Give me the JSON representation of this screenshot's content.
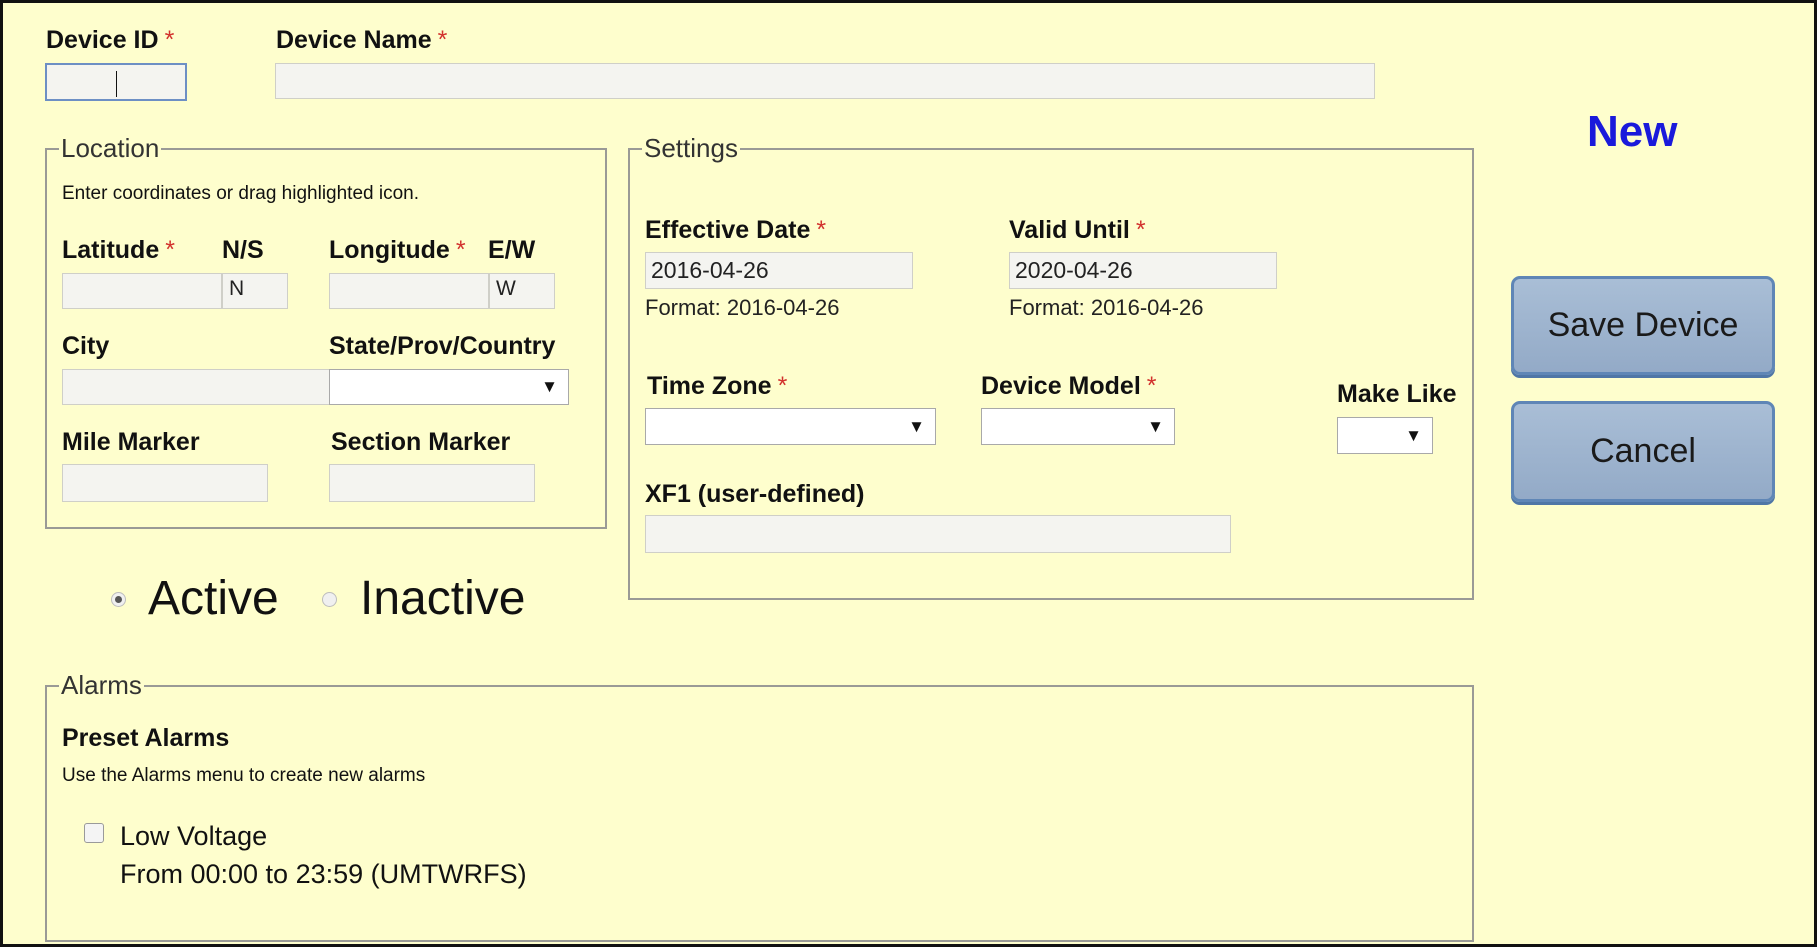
{
  "required_mark": "*",
  "device": {
    "id_label": "Device ID",
    "id_value": "",
    "name_label": "Device Name",
    "name_value": ""
  },
  "status_label": "New",
  "location": {
    "legend": "Location",
    "hint": "Enter coordinates or drag highlighted icon.",
    "latitude_label": "Latitude",
    "ns_label": "N/S",
    "ns_value": "N",
    "longitude_label": "Longitude",
    "ew_label": "E/W",
    "ew_value": "W",
    "city_label": "City",
    "state_label": "State/Prov/Country",
    "mile_marker_label": "Mile Marker",
    "section_marker_label": "Section Marker"
  },
  "activity": {
    "active_label": "Active",
    "inactive_label": "Inactive",
    "selected": "Active"
  },
  "settings": {
    "legend": "Settings",
    "effective_date_label": "Effective Date",
    "effective_date_value": "2016-04-26",
    "effective_date_format": "Format: 2016-04-26",
    "valid_until_label": "Valid Until",
    "valid_until_value": "2020-04-26",
    "valid_until_format": "Format: 2016-04-26",
    "time_zone_label": "Time Zone",
    "device_model_label": "Device Model",
    "make_like_label": "Make Like",
    "xf1_label": "XF1 (user-defined)"
  },
  "buttons": {
    "save_label": "Save Device",
    "cancel_label": "Cancel"
  },
  "alarms": {
    "legend": "Alarms",
    "preset_title": "Preset Alarms",
    "hint": "Use the Alarms menu to create new alarms",
    "items": [
      {
        "label": "Low Voltage",
        "schedule": "From 00:00 to 23:59 (UMTWRFS)",
        "checked": false
      }
    ]
  },
  "icons": {
    "dropdown_arrow": "▼"
  },
  "colors": {
    "background": "#fefecd",
    "required": "#d2322d",
    "status": "#1a1adb",
    "button": "#a9bed6"
  }
}
